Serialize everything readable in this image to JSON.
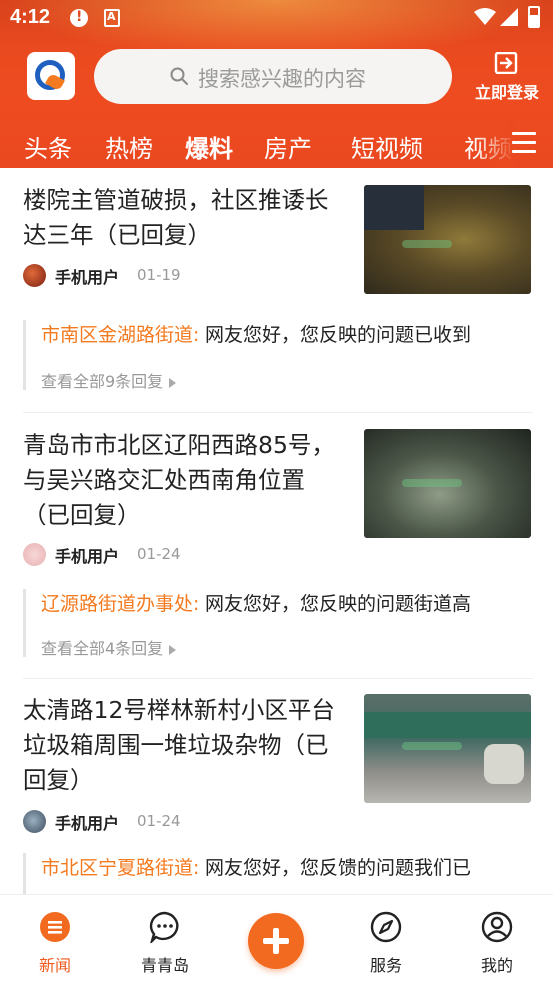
{
  "status_bar": {
    "time": "4:12"
  },
  "header": {
    "search_placeholder": "搜索感兴趣的内容",
    "login_label": "立即登录"
  },
  "tabs": [
    {
      "label": "头条",
      "active": false
    },
    {
      "label": "热榜",
      "active": false
    },
    {
      "label": "爆料",
      "active": true
    },
    {
      "label": "房产",
      "active": false
    },
    {
      "label": "短视频",
      "active": false
    },
    {
      "label": "视频",
      "active": false
    }
  ],
  "feed": [
    {
      "title": "楼院主管道破损，社区推诿长达三年（已回复）",
      "author": "手机用户",
      "date": "01-19",
      "reply_dept": "市南区金湖路街道:",
      "reply_text": "网友您好，您反映的问题已收到",
      "reply_more": "查看全部9条回复"
    },
    {
      "title": "青岛市市北区辽阳西路85号，与吴兴路交汇处西南角位置（已回复）",
      "author": "手机用户",
      "date": "01-24",
      "reply_dept": "辽源路街道办事处:",
      "reply_text": "网友您好，您反映的问题街道高",
      "reply_more": "查看全部4条回复"
    },
    {
      "title": "太清路12号榉林新村小区平台垃圾箱周围一堆垃圾杂物（已回复）",
      "author": "手机用户",
      "date": "01-24",
      "reply_dept": "市北区宁夏路街道:",
      "reply_text": "网友您好，您反馈的问题我们已",
      "reply_more": ""
    }
  ],
  "bottom_nav": [
    {
      "label": "新闻",
      "icon": "news-icon",
      "active": true
    },
    {
      "label": "青青岛",
      "icon": "chat-icon",
      "active": false
    },
    {
      "label": "",
      "icon": "plus-icon",
      "active": false
    },
    {
      "label": "服务",
      "icon": "compass-icon",
      "active": false
    },
    {
      "label": "我的",
      "icon": "user-icon",
      "active": false
    }
  ],
  "colors": {
    "brand": "#ea4a1f",
    "accent_orange": "#f47a1f",
    "active_nav": "#f05a1e"
  }
}
